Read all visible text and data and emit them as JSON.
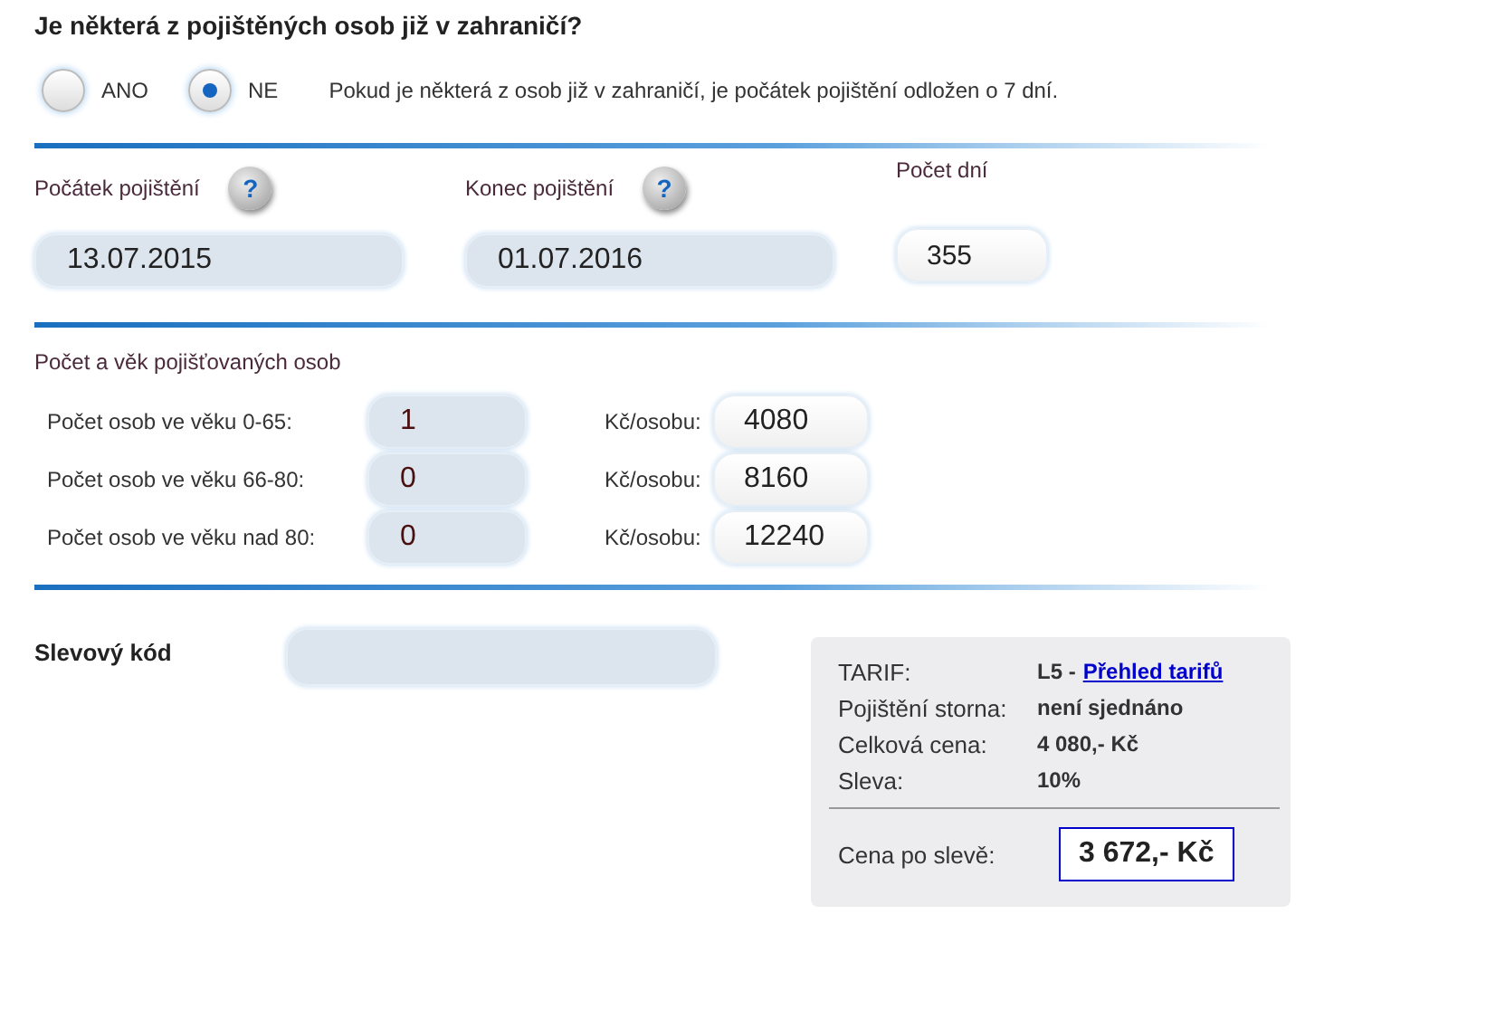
{
  "question": "Je některá z pojištěných osob již v zahraničí?",
  "abroad_options": [
    {
      "label": "ANO",
      "selected": false
    },
    {
      "label": "NE",
      "selected": true
    }
  ],
  "abroad_note": "Pokud je některá z osob již v zahraničí, je počátek pojištění odložen o 7 dní.",
  "dates": [
    {
      "label": "Počátek pojištění",
      "value": "13.07.2015",
      "help": "?"
    },
    {
      "label": "Konec pojištění",
      "value": "01.07.2016",
      "help": "?"
    }
  ],
  "days": {
    "label": "Počet dní",
    "value": "355"
  },
  "persons_title": "Počet a věk pojišťovaných osob",
  "persons": [
    {
      "label": "Počet osob ve věku 0-65:",
      "count": "1",
      "price_label": "Kč/osobu:",
      "price": "4080"
    },
    {
      "label": "Počet osob ve věku 66-80:",
      "count": "0",
      "price_label": "Kč/osobu:",
      "price": "8160"
    },
    {
      "label": "Počet osob ve věku nad 80:",
      "count": "0",
      "price_label": "Kč/osobu:",
      "price": "12240"
    }
  ],
  "discount_code": {
    "label": "Slevový kód"
  },
  "summary": {
    "rows": [
      {
        "label": "TARIF:",
        "value": "L5 -",
        "link": "Přehled tarifů"
      },
      {
        "label": "Pojištění storna:",
        "value": "není sjednáno"
      },
      {
        "label": "Celková cena:",
        "value": "4 080,- Kč"
      },
      {
        "label": "Sleva:",
        "value": "10%"
      }
    ],
    "final_label": "Cena po slevě:",
    "final_value": "3 672,- Kč"
  }
}
